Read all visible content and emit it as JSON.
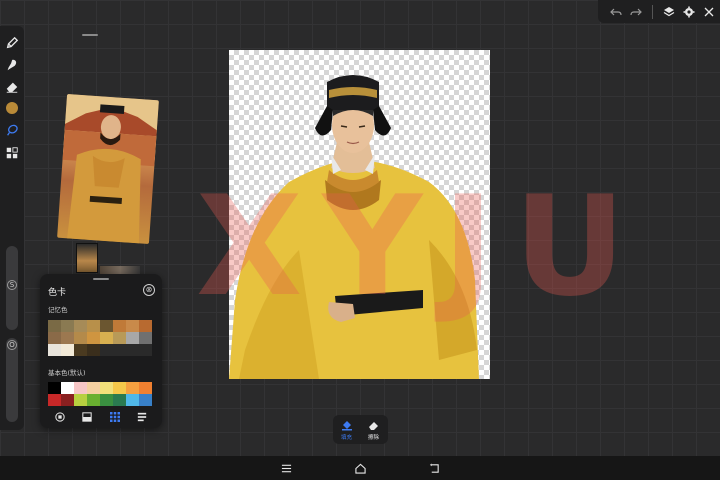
{
  "colors": {
    "accent": "#3d7bf2",
    "toolbar_bg": "#1f1f20",
    "current_color": "#b98a38",
    "watermark": "#e85a52"
  },
  "left_toolbar": {
    "tools": [
      {
        "name": "brush-icon"
      },
      {
        "name": "smudge-icon"
      },
      {
        "name": "eraser-icon"
      },
      {
        "name": "color-dot"
      },
      {
        "name": "lasso-icon"
      },
      {
        "name": "layers-grid-icon"
      }
    ],
    "size_slider_label": "S",
    "opacity_slider_label": "O"
  },
  "top_toolbar": {
    "icons": [
      "undo-icon",
      "redo-icon",
      "layers-icon",
      "settings-icon",
      "close-icon"
    ]
  },
  "color_panel": {
    "title": "色卡",
    "close_glyph": "⊗",
    "memory_label": "记忆色",
    "memory_colors": [
      "#7a6a45",
      "#8a7a52",
      "#a68b58",
      "#b8904a",
      "#6b5630",
      "#c07a38",
      "#c98a4a",
      "#b86a30",
      "#8a6a48",
      "#9c7850",
      "#b48a4a",
      "#cf9540",
      "#d8b050",
      "#b89a58",
      "#a8a8a8",
      "#707070",
      "#e8e4dc",
      "#f2ead8",
      "#4a3a20",
      "#3a2e1c",
      "#2a2a2a",
      "#2a2a2a",
      "#2a2a2a",
      "#2a2a2a"
    ],
    "basic_label": "基本色(默认)",
    "basic_colors": [
      "#000000",
      "#ffffff",
      "#f7c6c6",
      "#f5d0a0",
      "#f2e07a",
      "#f5c84a",
      "#f5a040",
      "#f08030",
      "#c82828",
      "#8a2020",
      "#b8d040",
      "#6ab030",
      "#3a9040",
      "#2a7a50",
      "#50b8e8",
      "#3880c8"
    ],
    "tabs": [
      "palette-circle-icon",
      "image-icon",
      "grid-icon",
      "list-icon"
    ]
  },
  "watermark_text": "XYJU",
  "fill_erase": {
    "fill_label": "填充",
    "erase_label": "擦除"
  },
  "nav_bar": {
    "icons": [
      "menu-icon",
      "home-icon",
      "back-icon"
    ]
  }
}
